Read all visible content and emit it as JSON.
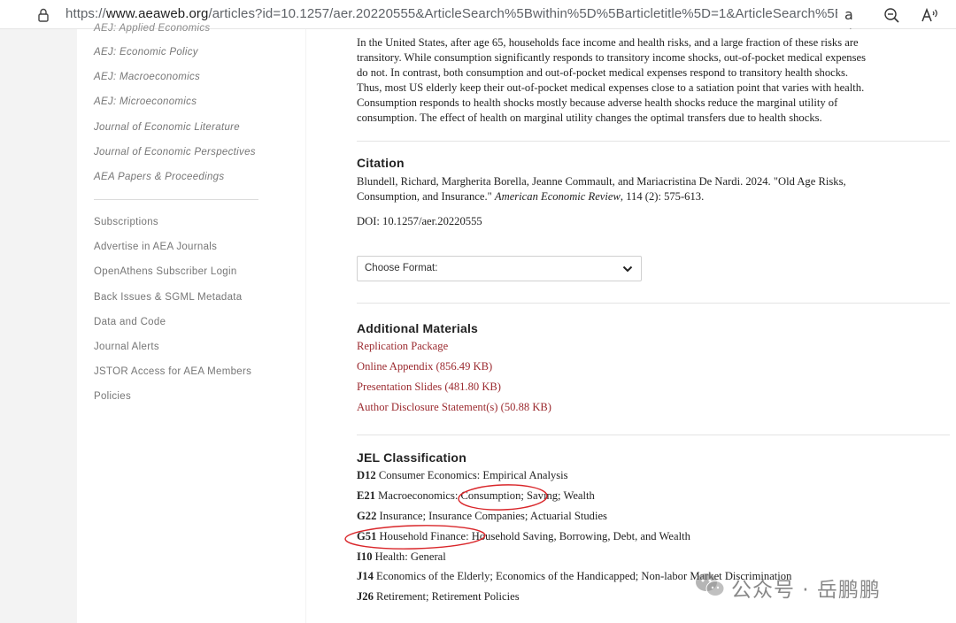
{
  "browser": {
    "url_scheme": "https://",
    "url_host": "www.aeaweb.org",
    "url_path": "/articles?id=10.1257/aer.20220555&ArticleSearch%5Bwithin%5D%5Barticletitle%5D=1&ArticleSearch%5B...",
    "read_mode_glyph": "aあ",
    "icons": [
      "lock-icon",
      "read-mode-icon",
      "zoom-icon",
      "read-aloud-icon"
    ]
  },
  "sidebar": {
    "cut_item": "AEJ: Applied Economics",
    "journals": [
      "AEJ: Economic Policy",
      "AEJ: Macroeconomics",
      "AEJ: Microeconomics",
      "Journal of Economic Literature",
      "Journal of Economic Perspectives",
      "AEA Papers & Proceedings"
    ],
    "links": [
      "Subscriptions",
      "Advertise in AEA Journals",
      "OpenAthens Subscriber Login",
      "Back Issues & SGML Metadata",
      "Data and Code",
      "Journal Alerts",
      "JSTOR Access for AEA Members",
      "Policies"
    ]
  },
  "article": {
    "abstract_lines": [
      "In the United States, after age 65, households face income and health risks, and a large fraction of these risks are",
      "transitory. While consumption significantly responds to transitory income shocks, out-of-pocket medical expenses",
      "do not. In contrast, both consumption and out-of-pocket medical expenses respond to transitory health shocks.",
      "Thus, most US elderly keep their out-of-pocket medical expenses close to a satiation point that varies with health.",
      "Consumption responds to health shocks mostly because adverse health shocks reduce the marginal utility of",
      "consumption. The effect of health on marginal utility changes the optimal transfers due to health shocks."
    ],
    "citation": {
      "heading": "Citation",
      "line1": "Blundell, Richard, Margherita Borella, Jeanne Commault, and Mariacristina De Nardi. 2024. \"Old Age Risks,",
      "line2_prefix": "Consumption, and Insurance.\" ",
      "journal": "American Economic Review",
      "line2_suffix": ", 114 (2): 575-613.",
      "doi": "DOI: 10.1257/aer.20220555"
    },
    "format_select": {
      "label": "Choose Format:"
    },
    "materials": {
      "heading": "Additional Materials",
      "links": [
        "Replication Package",
        "Online Appendix (856.49 KB)",
        "Presentation Slides (481.80 KB)",
        "Author Disclosure Statement(s) (50.88 KB)"
      ]
    },
    "jel": {
      "heading": "JEL Classification",
      "items": [
        {
          "code": "D12",
          "text": "Consumer Economics: Empirical Analysis"
        },
        {
          "code": "E21",
          "text": "Macroeconomics: Consumption; Saving; Wealth"
        },
        {
          "code": "G22",
          "text": "Insurance; Insurance Companies; Actuarial Studies"
        },
        {
          "code": "G51",
          "text": "Household Finance: Household Saving, Borrowing, Debt, and Wealth"
        },
        {
          "code": "I10",
          "text": "Health: General"
        },
        {
          "code": "J14",
          "text": "Economics of the Elderly; Economics of the Handicapped; Non-labor Market Discrimination"
        },
        {
          "code": "J26",
          "text": "Retirement; Retirement Policies"
        }
      ]
    }
  },
  "watermark": {
    "text": "公众号 · 岳鹏鹏",
    "icon": "wechat-logo-icon"
  },
  "colors": {
    "link": "#9b2a2f",
    "annotation": "#d9262a"
  }
}
